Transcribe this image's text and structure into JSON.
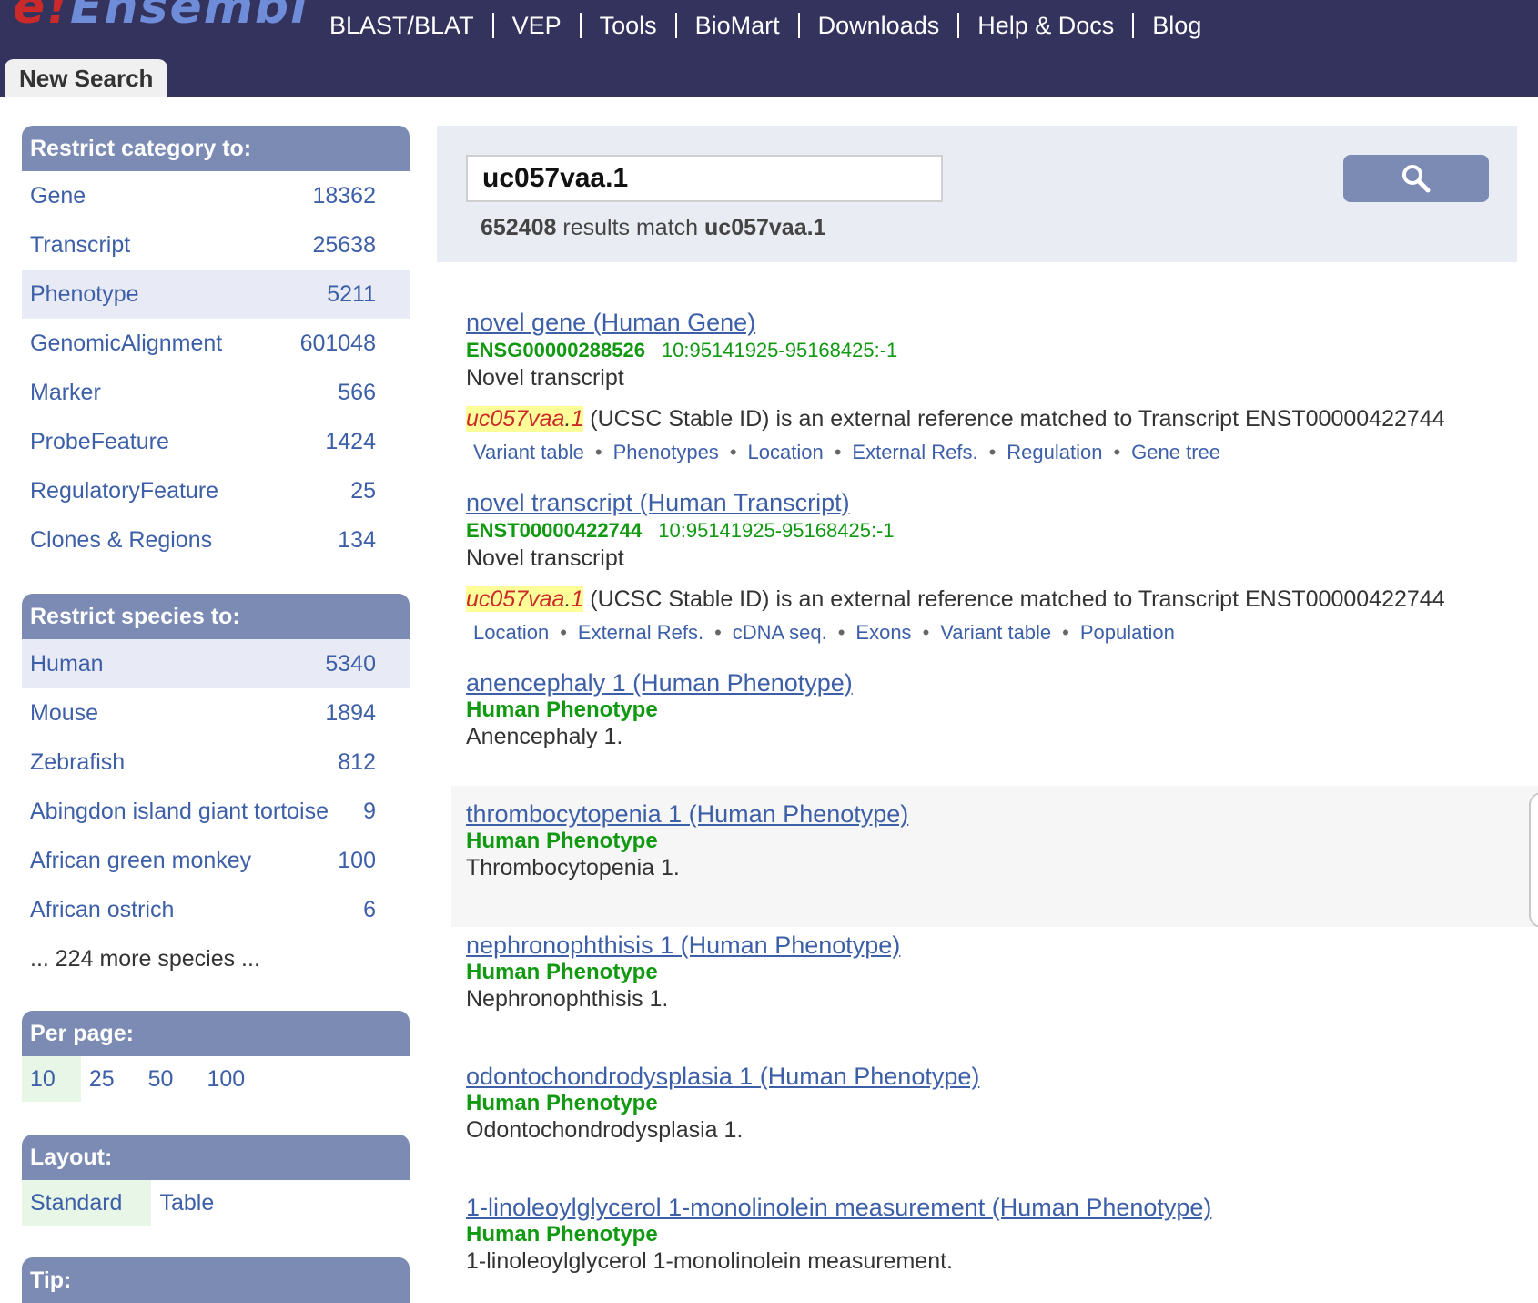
{
  "header": {
    "logo_text": "Ensembl",
    "nav": [
      "BLAST/BLAT",
      "VEP",
      "Tools",
      "BioMart",
      "Downloads",
      "Help & Docs",
      "Blog"
    ],
    "tab_label": "New Search"
  },
  "sidebar": {
    "category": {
      "title": "Restrict category to:",
      "items": [
        {
          "label": "Gene",
          "count": "18362"
        },
        {
          "label": "Transcript",
          "count": "25638"
        },
        {
          "label": "Phenotype",
          "count": "5211"
        },
        {
          "label": "GenomicAlignment",
          "count": "601048"
        },
        {
          "label": "Marker",
          "count": "566"
        },
        {
          "label": "ProbeFeature",
          "count": "1424"
        },
        {
          "label": "RegulatoryFeature",
          "count": "25"
        },
        {
          "label": "Clones & Regions",
          "count": "134"
        }
      ]
    },
    "species": {
      "title": "Restrict species to:",
      "items": [
        {
          "label": "Human",
          "count": "5340"
        },
        {
          "label": "Mouse",
          "count": "1894"
        },
        {
          "label": "Zebrafish",
          "count": "812"
        },
        {
          "label": "Abingdon island giant tortoise",
          "count": "9"
        },
        {
          "label": "African green monkey",
          "count": "100"
        },
        {
          "label": "African ostrich",
          "count": "6"
        }
      ],
      "more": "... 224 more species ..."
    },
    "per_page": {
      "title": "Per page:",
      "options": [
        "10",
        "25",
        "50",
        "100"
      ]
    },
    "layout": {
      "title": "Layout:",
      "options": [
        "Standard",
        "Table"
      ]
    },
    "tip": {
      "title": "Tip:"
    }
  },
  "search": {
    "query": "uc057vaa.1",
    "summary_count": "652408",
    "summary_text": "results match",
    "summary_query": "uc057vaa.1"
  },
  "results": [
    {
      "title": "novel gene (Human Gene)",
      "stable_id": "ENSG00000288526",
      "location": "10:95141925-95168425:-1",
      "desc": "Novel transcript",
      "xref_hl_a": "uc057vaa",
      "xref_hl_b": ".",
      "xref_hl_c": "1",
      "xref_text": " (UCSC Stable ID) is an external reference matched to Transcript ENST00000422744",
      "links": [
        "Variant table",
        "Phenotypes",
        "Location",
        "External Refs.",
        "Regulation",
        "Gene tree"
      ]
    },
    {
      "title": "novel transcript (Human Transcript)",
      "stable_id": "ENST00000422744",
      "location": "10:95141925-95168425:-1",
      "desc": "Novel transcript",
      "xref_hl_a": "uc057vaa",
      "xref_hl_b": ".",
      "xref_hl_c": "1",
      "xref_text": " (UCSC Stable ID) is an external reference matched to Transcript ENST00000422744",
      "links": [
        "Location",
        "External Refs.",
        "cDNA seq.",
        "Exons",
        "Variant table",
        "Population"
      ]
    },
    {
      "title": "anencephaly 1 (Human Phenotype)",
      "subtitle": "Human Phenotype",
      "desc": "Anencephaly 1."
    },
    {
      "title": "thrombocytopenia 1 (Human Phenotype)",
      "subtitle": "Human Phenotype",
      "desc": "Thrombocytopenia 1."
    },
    {
      "title": "nephronophthisis 1 (Human Phenotype)",
      "subtitle": "Human Phenotype",
      "desc": "Nephronophthisis 1."
    },
    {
      "title": "odontochondrodysplasia 1 (Human Phenotype)",
      "subtitle": "Human Phenotype",
      "desc": "Odontochondrodysplasia 1."
    },
    {
      "title": "1-linoleoylglycerol 1-monolinolein measurement (Human Phenotype)",
      "subtitle": "Human Phenotype",
      "desc": "1-linoleoylglycerol 1-monolinolein measurement."
    }
  ]
}
